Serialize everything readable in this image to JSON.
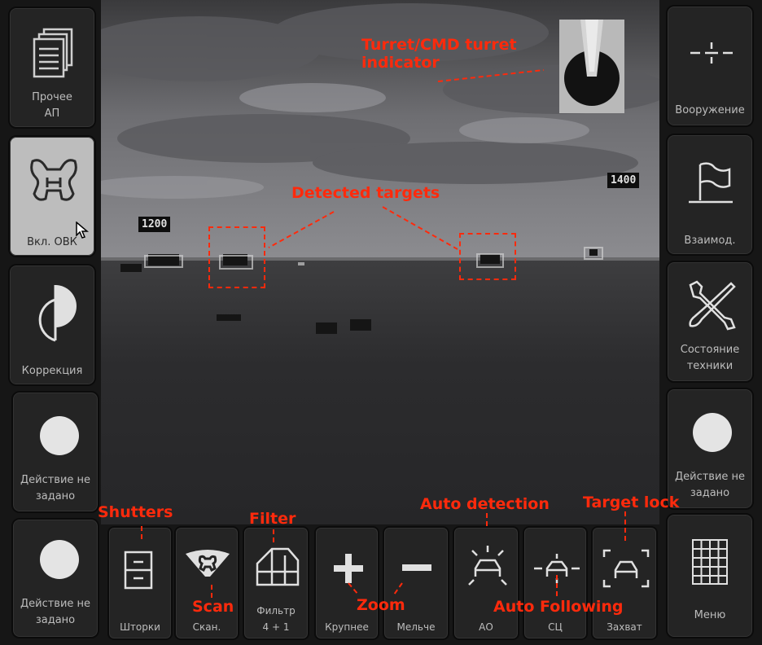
{
  "left_panel": [
    {
      "label": "Прочее\nАП",
      "icon": "documents-icon"
    },
    {
      "label": "Вкл. ОВК",
      "icon": "turret-h-icon",
      "active": true
    },
    {
      "label": "Коррекция",
      "icon": "half-circle-icon"
    },
    {
      "label": "Действие не\nзадано",
      "icon": "circle-icon"
    },
    {
      "label": "Действие не\nзадано",
      "icon": "circle-icon"
    }
  ],
  "right_panel": [
    {
      "label": "Вооружение",
      "icon": "crosshair-icon"
    },
    {
      "label": "Взаимод.",
      "icon": "flag-icon"
    },
    {
      "label": "Состояние\nтехники",
      "icon": "tools-icon"
    },
    {
      "label": "Действие не\nзадано",
      "icon": "circle-icon"
    },
    {
      "label": "Меню",
      "icon": "grid-icon"
    }
  ],
  "bottom_panel": [
    {
      "label": "Шторки",
      "icon": "shutters-icon"
    },
    {
      "label": "Скан.",
      "icon": "scan-icon"
    },
    {
      "label": "Фильтр\n4 + 1",
      "icon": "filter-icon"
    },
    {
      "label": "Крупнее",
      "icon": "plus-icon"
    },
    {
      "label": "Мельче",
      "icon": "minus-icon"
    },
    {
      "label": "АО",
      "icon": "auto-detection-icon"
    },
    {
      "label": "СЦ",
      "icon": "auto-following-icon"
    },
    {
      "label": "Захват",
      "icon": "target-lock-icon"
    }
  ],
  "view": {
    "distance_labels": [
      "1200",
      "1400"
    ]
  },
  "annotations": {
    "turret": "Turret/CMD turret\nindicator",
    "detected": "Detected targets",
    "shutters": "Shutters",
    "filter": "Filter",
    "auto_detection": "Auto detection",
    "target_lock": "Target lock",
    "scan": "Scan",
    "zoom": "Zoom",
    "auto_following": "Auto Following"
  },
  "colors": {
    "annotation": "#ff2a0c",
    "panel_bg": "#242424",
    "active_bg": "#bdbdbd",
    "label": "#bdbdbd"
  }
}
